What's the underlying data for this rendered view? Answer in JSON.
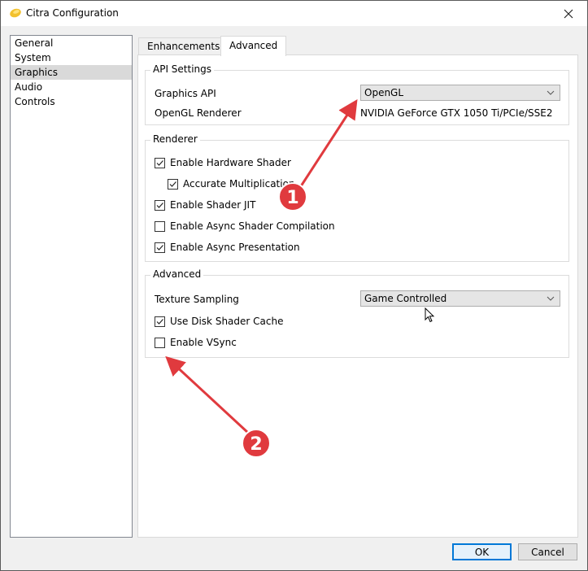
{
  "window": {
    "title": "Citra Configuration",
    "close_icon": "close-icon",
    "app_icon": "citra-logo-icon"
  },
  "sidebar": {
    "items": [
      {
        "label": "General",
        "selected": false
      },
      {
        "label": "System",
        "selected": false
      },
      {
        "label": "Graphics",
        "selected": true
      },
      {
        "label": "Audio",
        "selected": false
      },
      {
        "label": "Controls",
        "selected": false
      }
    ]
  },
  "tabs": [
    {
      "label": "Enhancements",
      "active": false
    },
    {
      "label": "Advanced",
      "active": true
    }
  ],
  "api_settings": {
    "title": "API Settings",
    "graphics_api_label": "Graphics API",
    "graphics_api_value": "OpenGL",
    "renderer_label": "OpenGL Renderer",
    "renderer_value": "NVIDIA GeForce GTX 1050 Ti/PCIe/SSE2"
  },
  "renderer": {
    "title": "Renderer",
    "options": [
      {
        "label": "Enable Hardware Shader",
        "checked": true
      },
      {
        "label": "Accurate Multiplication",
        "checked": true
      },
      {
        "label": "Enable Shader JIT",
        "checked": true
      },
      {
        "label": "Enable Async Shader Compilation",
        "checked": false
      },
      {
        "label": "Enable Async Presentation",
        "checked": true
      }
    ]
  },
  "advanced": {
    "title": "Advanced",
    "texture_sampling_label": "Texture Sampling",
    "texture_sampling_value": "Game Controlled",
    "options": [
      {
        "label": "Use Disk Shader Cache",
        "checked": true
      },
      {
        "label": "Enable VSync",
        "checked": false
      }
    ]
  },
  "buttons": {
    "ok": "OK",
    "cancel": "Cancel"
  },
  "annotations": {
    "color": "#e03a3e",
    "markers": [
      {
        "label": "1"
      },
      {
        "label": "2"
      }
    ]
  }
}
